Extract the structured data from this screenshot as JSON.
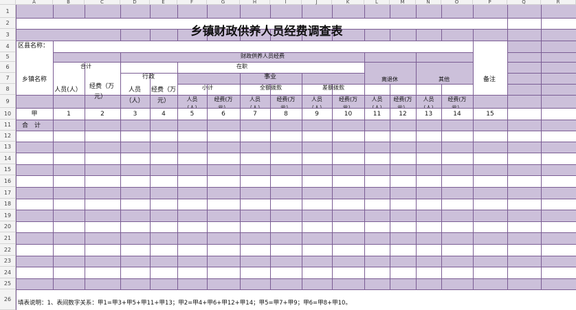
{
  "sheet": {
    "column_letters": [
      "A",
      "B",
      "C",
      "D",
      "E",
      "F",
      "G",
      "H",
      "I",
      "J",
      "K",
      "L",
      "M",
      "N",
      "O",
      "P",
      "Q",
      "R"
    ],
    "row_numbers": [
      "1",
      "2",
      "3",
      "4",
      "5",
      "6",
      "7",
      "8",
      "9",
      "10",
      "11",
      "12",
      "13",
      "14",
      "15",
      "16",
      "17",
      "18",
      "19",
      "20",
      "21",
      "22",
      "23",
      "24",
      "25",
      "26"
    ]
  },
  "title": "乡镇财政供养人员经费调查表",
  "county_label": "区县名称：",
  "header": {
    "township": "乡镇名称",
    "fiscal_funding": "财政供养人员经费",
    "total": "合计",
    "in_service": "在职",
    "admin": "行政",
    "institution": "事业",
    "subtotal": "小计",
    "full_funding": "全额拨款",
    "diff_funding": "差额拨款",
    "retired": "离退休",
    "other": "其他",
    "remark": "备注",
    "persons": "人员(人）",
    "funds_line1": "经费（万",
    "funds_line2": "元）",
    "persons_l1": "人员",
    "persons_l2": "（人）",
    "funds_a_l1": "经费（万",
    "funds_a_l2": "元）",
    "small_persons": "人员",
    "small_persons_cut": "（人）",
    "small_funds": "经费(万",
    "small_funds_cut": "元）"
  },
  "index_row": [
    "甲",
    "1",
    "2",
    "3",
    "4",
    "5",
    "6",
    "7",
    "8",
    "9",
    "10",
    "11",
    "12",
    "13",
    "14",
    "15"
  ],
  "total_row_label": "合　计",
  "footnote": "填表说明：1、表间数字关系：甲1=甲3+甲5+甲11+甲13；甲2=甲4+甲6+甲12+甲14；甲5=甲7+甲9；甲6=甲8+甲10。",
  "colors": {
    "band": "#ccc0da",
    "grid": "#7a5c93",
    "header_bg": "#f3f3f3"
  }
}
